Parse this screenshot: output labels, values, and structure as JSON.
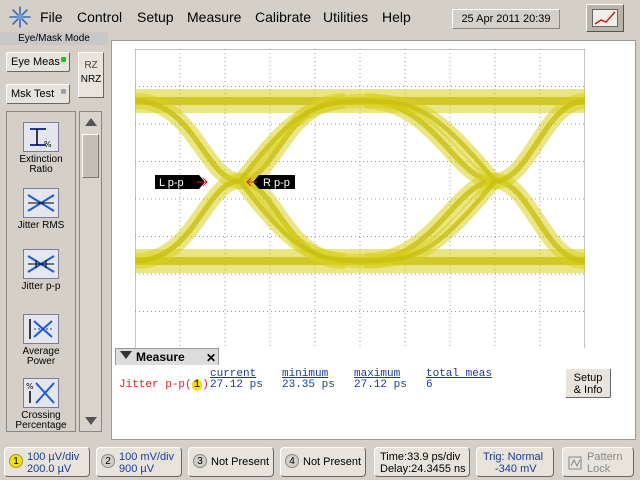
{
  "menu": {
    "file": "File",
    "control": "Control",
    "setup": "Setup",
    "measure": "Measure",
    "calibrate": "Calibrate",
    "utilities": "Utilities",
    "help": "Help"
  },
  "datetime": "25 Apr 2011   20:39",
  "mode_label": "Eye/Mask Mode",
  "buttons": {
    "eye_meas": "Eye Meas",
    "mask_test": "Msk Test",
    "rz": "RZ",
    "nrz": "NRZ"
  },
  "meas_items": [
    {
      "label": "Extinction Ratio",
      "icon": "extinction-ratio-icon"
    },
    {
      "label": "Jitter RMS",
      "icon": "jitter-rms-icon"
    },
    {
      "label": "Jitter p-p",
      "icon": "jitter-pp-icon"
    },
    {
      "label": "Average Power",
      "icon": "average-power-icon"
    },
    {
      "label": "Crossing Percentage",
      "icon": "crossing-percentage-icon"
    }
  ],
  "markers": {
    "left": "L p-p",
    "right": "R p-p"
  },
  "meas_panel": {
    "tab": "Measure",
    "headers": {
      "current": "current",
      "minimum": "minimum",
      "maximum": "maximum",
      "total": "total meas"
    },
    "row": {
      "name": "Jitter p-p(",
      "channel": "1",
      "name_end": ")",
      "current": "27.12 ps",
      "minimum": "23.35 ps",
      "maximum": "27.12 ps",
      "total": "6"
    },
    "setup_info_line1": "Setup",
    "setup_info_line2": "& Info"
  },
  "channels": [
    {
      "num": "1",
      "line1": "100 µV/div",
      "line2": "200.0 µV",
      "color": "#f0e020"
    },
    {
      "num": "2",
      "line1": "100 mV/div",
      "line2": "900 µV",
      "color": "#d4d0c8"
    },
    {
      "num": "3",
      "line1": "Not Present",
      "line2": "",
      "color": "#d4d0c8"
    },
    {
      "num": "4",
      "line1": "Not Present",
      "line2": "",
      "color": "#d4d0c8"
    }
  ],
  "timebase": {
    "line1": "Time:33.9 ps/div",
    "line2": "Delay:24.3455 ns"
  },
  "trigger": {
    "line1": "Trig: Normal",
    "line2": "-340 mV"
  },
  "pattern_lock": {
    "line1": "Pattern",
    "line2": "Lock"
  },
  "colors": {
    "trace": "#d8d020",
    "measurement_text": "#1a3a9a",
    "measurement_name": "#e02020"
  }
}
